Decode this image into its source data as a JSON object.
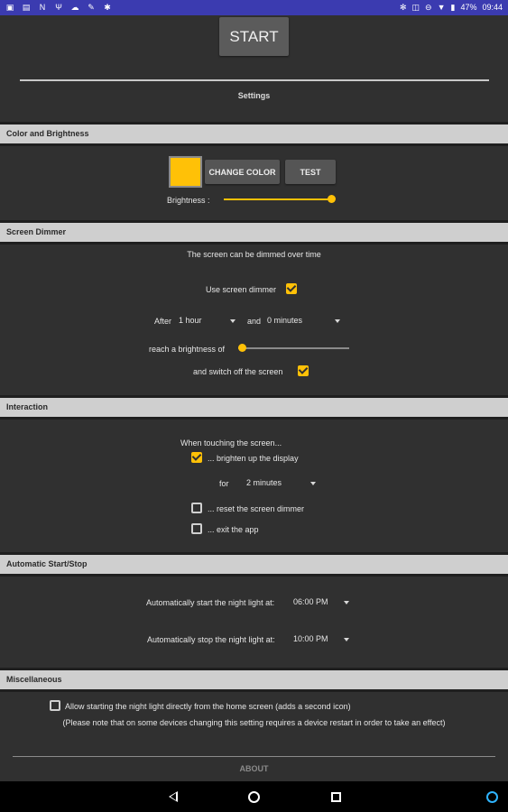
{
  "status_bar": {
    "left_icons": [
      "image-icon",
      "photo-icon",
      "n-icon",
      "usb-icon",
      "cloud-icon",
      "wrench-icon",
      "gear-icon"
    ],
    "battery": "47%",
    "time": "09:44"
  },
  "start_label": "START",
  "settings_title": "Settings",
  "sections": {
    "color": {
      "header": "Color and Brightness",
      "change_color_label": "CHANGE COLOR",
      "test_label": "TEST",
      "brightness_label": "Brightness :",
      "brightness_level": 1.0,
      "swatch_color": "#ffc107"
    },
    "dimmer": {
      "header": "Screen Dimmer",
      "description": "The screen can be dimmed over time",
      "use_dimmer_label": "Use screen dimmer",
      "use_dimmer_checked": true,
      "after_label": "After",
      "after_value": "1 hour",
      "and_label": "and",
      "and_value": "0 minutes",
      "reach_label": "reach a brightness of",
      "reach_level": 0.0,
      "switch_off_label": "and switch off the screen",
      "switch_off_checked": true
    },
    "interaction": {
      "header": "Interaction",
      "when_touching": "When touching the screen...",
      "brighten_label": "... brighten up the display",
      "brighten_checked": true,
      "for_label": "for",
      "for_value": "2 minutes",
      "reset_label": "... reset the screen dimmer",
      "reset_checked": false,
      "exit_label": "... exit the app",
      "exit_checked": false
    },
    "auto": {
      "header": "Automatic Start/Stop",
      "start_label": "Automatically start the night light at:",
      "start_value": "06:00 PM",
      "stop_label": "Automatically stop the night light at:",
      "stop_value": "10:00 PM"
    },
    "misc": {
      "header": "Miscellaneous",
      "allow_label": "Allow starting the night light directly from the home screen (adds a second icon)",
      "allow_checked": false,
      "note": "(Please note that on some devices changing this setting requires a device restart in order to take an effect)"
    }
  },
  "about_label": "ABOUT",
  "colors": {
    "accent": "#ffc107",
    "status_bar": "#3b3bb0",
    "section_header": "#cfcfcf",
    "background": "#303030"
  }
}
